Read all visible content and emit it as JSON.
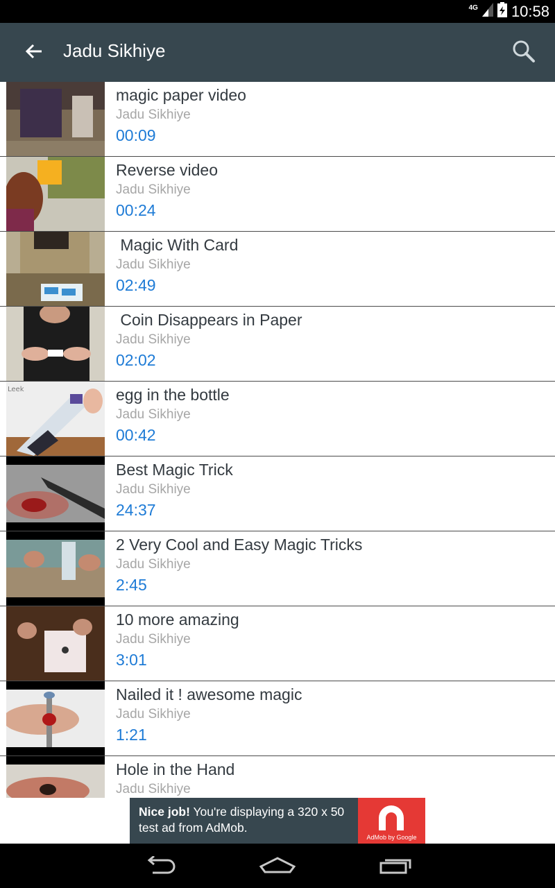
{
  "status_bar": {
    "network_type": "4G",
    "time": "10:58",
    "icons": [
      "signal-icon",
      "battery-icon"
    ]
  },
  "action_bar": {
    "title": "Jadu Sikhiye",
    "back_icon": "arrow-left-icon",
    "search_icon": "search-icon",
    "background_color": "#37474f"
  },
  "videos": [
    {
      "title": "magic paper video",
      "channel": "Jadu Sikhiye",
      "duration": "00:09"
    },
    {
      "title": "Reverse video",
      "channel": "Jadu Sikhiye",
      "duration": "00:24"
    },
    {
      "title": " Magic With Card",
      "channel": "Jadu Sikhiye",
      "duration": "02:49"
    },
    {
      "title": " Coin Disappears in Paper",
      "channel": "Jadu Sikhiye",
      "duration": "02:02"
    },
    {
      "title": "egg in the bottle",
      "channel": "Jadu Sikhiye",
      "duration": "00:42"
    },
    {
      "title": "Best Magic Trick",
      "channel": "Jadu Sikhiye",
      "duration": "24:37"
    },
    {
      "title": "2 Very Cool and Easy Magic Tricks",
      "channel": "Jadu Sikhiye",
      "duration": "2:45"
    },
    {
      "title": "10 more amazing",
      "channel": "Jadu Sikhiye",
      "duration": "3:01"
    },
    {
      "title": "Nailed it ! awesome magic",
      "channel": "Jadu Sikhiye",
      "duration": "1:21"
    },
    {
      "title": "Hole in the Hand",
      "channel": "Jadu Sikhiye",
      "duration": ""
    }
  ],
  "thumbnail_watermark": "Leek",
  "ad": {
    "headline": "Nice job!",
    "body": " You're displaying a 320 x 50 test ad from AdMob.",
    "logo_text": "AdMob by Google",
    "logo_color": "#e53935"
  },
  "nav_bar": {
    "buttons": [
      "back-nav-icon",
      "home-nav-icon",
      "recents-nav-icon"
    ]
  },
  "colors": {
    "title_text": "#333a40",
    "channel_text": "#a6a6a6",
    "duration_text": "#1e7bd6"
  }
}
